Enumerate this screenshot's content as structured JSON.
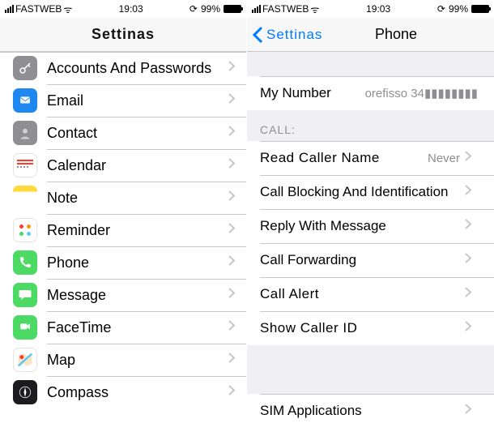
{
  "status": {
    "carrier": "FASTWEB",
    "time": "19:03",
    "battery": "99%"
  },
  "left": {
    "title": "Settinas",
    "items": [
      {
        "label": "Accounts And Passwords"
      },
      {
        "label": "Email"
      },
      {
        "label": "Contact"
      },
      {
        "label": "Calendar"
      },
      {
        "label": "Note"
      },
      {
        "label": "Reminder"
      },
      {
        "label": "Phone"
      },
      {
        "label": "Message"
      },
      {
        "label": "FaceTime"
      },
      {
        "label": "Map"
      },
      {
        "label": "Compass"
      }
    ]
  },
  "right": {
    "back": "Settinas",
    "title": "Phone",
    "my_number_label": "My Number",
    "my_number_value": "orefisso 34",
    "calls_header": "CALL:",
    "items": [
      {
        "label": "Read Caller Name",
        "value": "Never"
      },
      {
        "label": "Call Blocking And Identification",
        "value": ""
      },
      {
        "label": "Reply With Message",
        "value": ""
      },
      {
        "label": "Call Forwarding",
        "value": ""
      },
      {
        "label": "Call Alert",
        "value": ""
      },
      {
        "label": "Show Caller ID",
        "value": ""
      }
    ],
    "sim_label": "SIM Applications"
  }
}
